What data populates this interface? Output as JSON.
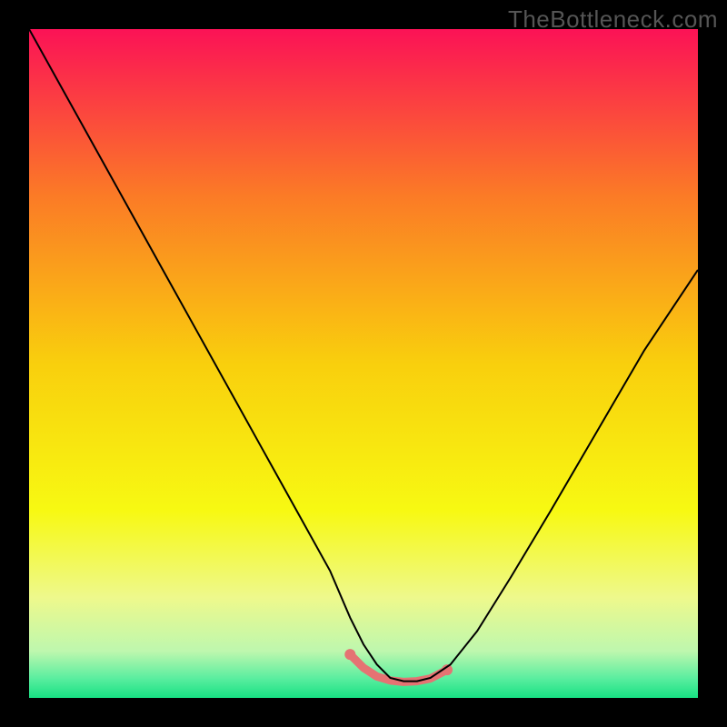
{
  "watermark": "TheBottleneck.com",
  "chart_data": {
    "type": "line",
    "title": "",
    "xlabel": "",
    "ylabel": "",
    "xlim": [
      0,
      100
    ],
    "ylim": [
      0,
      100
    ],
    "x": [
      0,
      5,
      10,
      15,
      20,
      25,
      30,
      35,
      40,
      45,
      48,
      50,
      52,
      54,
      56,
      58,
      60,
      63,
      67,
      72,
      78,
      85,
      92,
      100
    ],
    "y": [
      100,
      91,
      82,
      73,
      64,
      55,
      46,
      37,
      28,
      19,
      12,
      8,
      5,
      3,
      2.5,
      2.5,
      3,
      5,
      10,
      18,
      28,
      40,
      52,
      64
    ],
    "curve_color": "#000000",
    "bottom_segment": {
      "x": [
        48,
        50,
        52,
        54,
        56,
        58,
        60,
        62.5
      ],
      "y": [
        6.5,
        4.5,
        3.2,
        2.6,
        2.4,
        2.5,
        2.9,
        4.2
      ],
      "color": "#e57373",
      "line_width": 9
    },
    "background_gradient": [
      {
        "offset": 0.0,
        "color": "#fb1256"
      },
      {
        "offset": 0.25,
        "color": "#fb7b26"
      },
      {
        "offset": 0.5,
        "color": "#f9cf0d"
      },
      {
        "offset": 0.72,
        "color": "#f7f912"
      },
      {
        "offset": 0.85,
        "color": "#eef98c"
      },
      {
        "offset": 0.93,
        "color": "#bef7ae"
      },
      {
        "offset": 0.97,
        "color": "#5ceea0"
      },
      {
        "offset": 1.0,
        "color": "#17e183"
      }
    ]
  }
}
